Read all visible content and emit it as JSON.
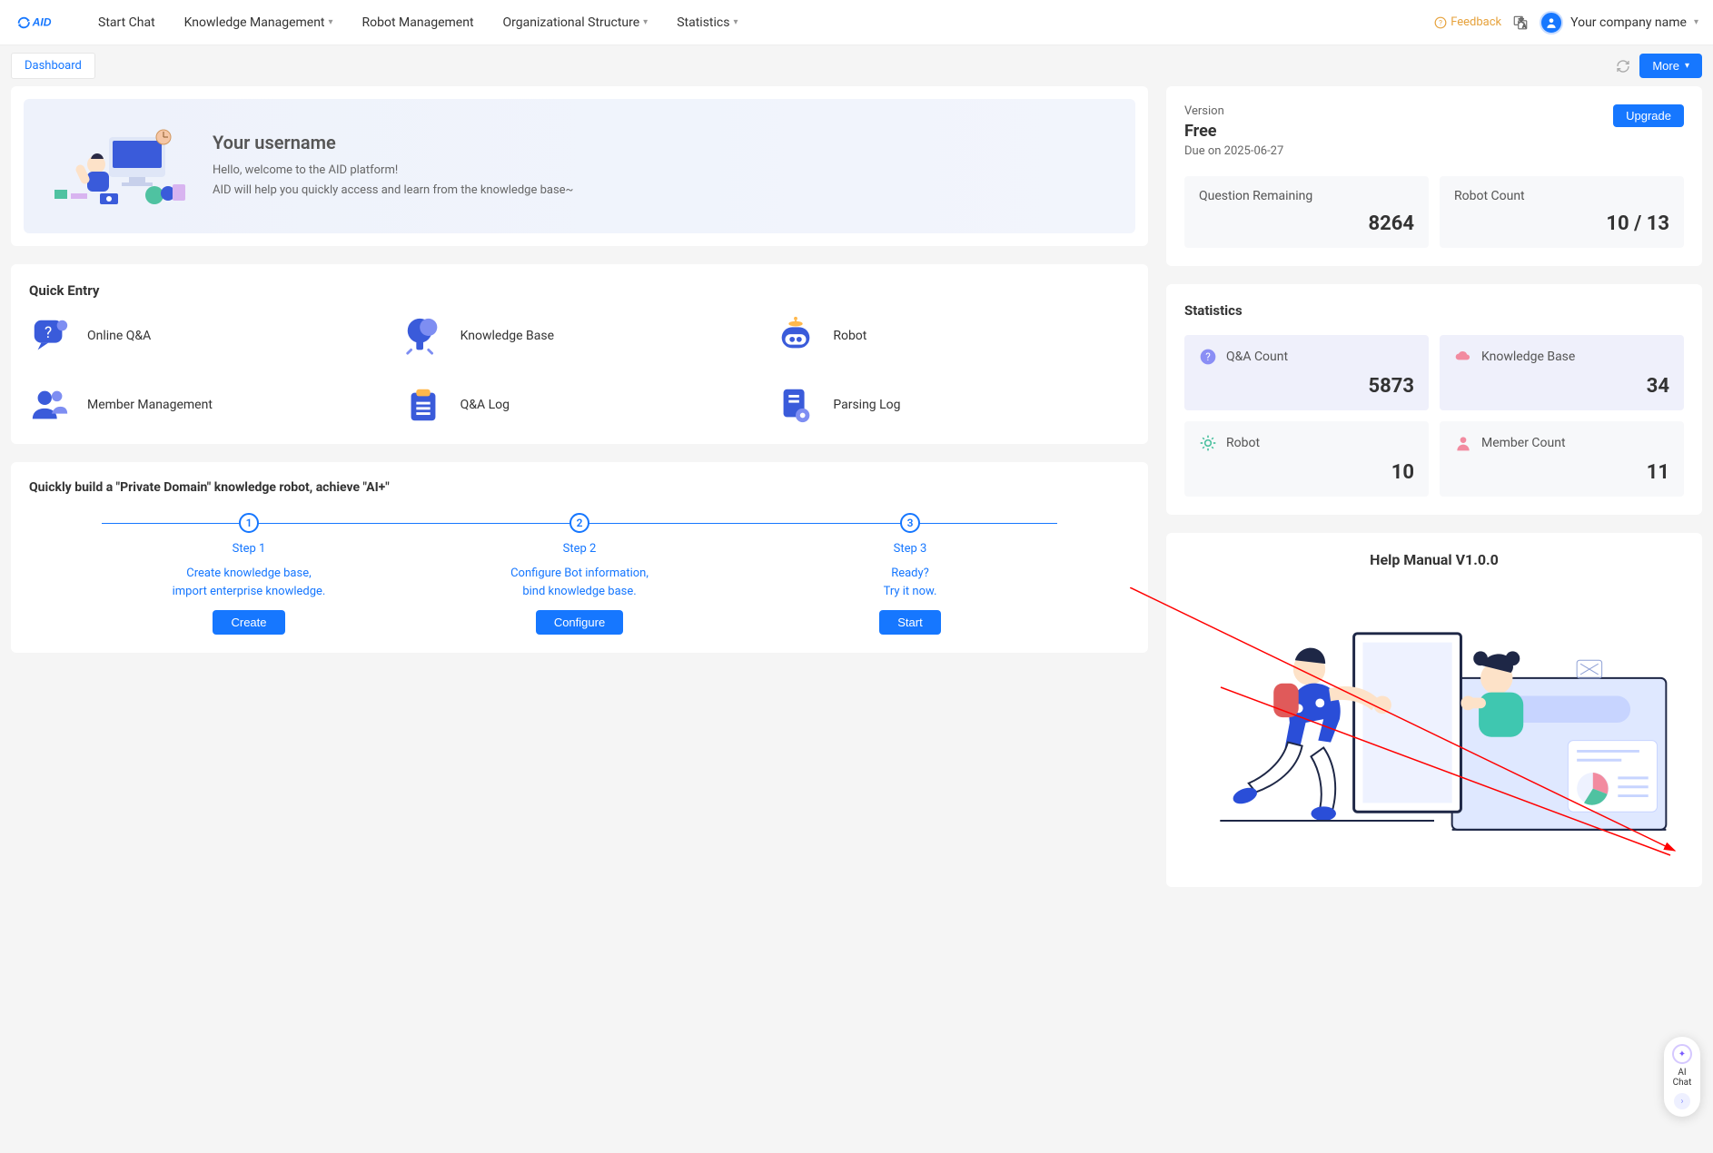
{
  "nav": {
    "items": [
      {
        "label": "Start Chat",
        "dropdown": false
      },
      {
        "label": "Knowledge Management",
        "dropdown": true
      },
      {
        "label": "Robot Management",
        "dropdown": false
      },
      {
        "label": "Organizational Structure",
        "dropdown": true
      },
      {
        "label": "Statistics",
        "dropdown": true
      }
    ],
    "feedback_label": "Feedback",
    "company_label": "Your company name"
  },
  "tabbar": {
    "dashboard_label": "Dashboard",
    "more_label": "More"
  },
  "welcome": {
    "username": "Your username",
    "line1": "Hello, welcome to the AID platform!",
    "line2": "AID will help you quickly access and learn from the knowledge base~"
  },
  "quick_entry": {
    "title": "Quick Entry",
    "items": [
      {
        "label": "Online Q&A"
      },
      {
        "label": "Knowledge Base"
      },
      {
        "label": "Robot"
      },
      {
        "label": "Member Management"
      },
      {
        "label": "Q&A Log"
      },
      {
        "label": "Parsing Log"
      }
    ]
  },
  "build": {
    "title": "Quickly build a \"Private Domain\" knowledge robot, achieve \"AI+\"",
    "steps": [
      {
        "num": "1",
        "label": "Step 1",
        "desc": "Create knowledge base,\nimport enterprise knowledge.",
        "btn": "Create"
      },
      {
        "num": "2",
        "label": "Step 2",
        "desc": "Configure Bot information,\nbind knowledge base.",
        "btn": "Configure"
      },
      {
        "num": "3",
        "label": "Step 3",
        "desc": "Ready?\nTry it now.",
        "btn": "Start"
      }
    ]
  },
  "version": {
    "label": "Version",
    "tier": "Free",
    "due": "Due on 2025-06-27",
    "upgrade_btn": "Upgrade",
    "question_remaining_label": "Question Remaining",
    "question_remaining_value": "8264",
    "robot_count_label": "Robot Count",
    "robot_count_value": "10 / 13"
  },
  "statistics": {
    "title": "Statistics",
    "qa_label": "Q&A Count",
    "qa_value": "5873",
    "kb_label": "Knowledge Base",
    "kb_value": "34",
    "robot_label": "Robot",
    "robot_value": "10",
    "member_label": "Member Count",
    "member_value": "11"
  },
  "manual": {
    "title": "Help Manual V1.0.0"
  },
  "ai_widget": {
    "label": "AI\nChat"
  },
  "colors": {
    "primary": "#1677ff",
    "warning": "#e6a23c"
  }
}
